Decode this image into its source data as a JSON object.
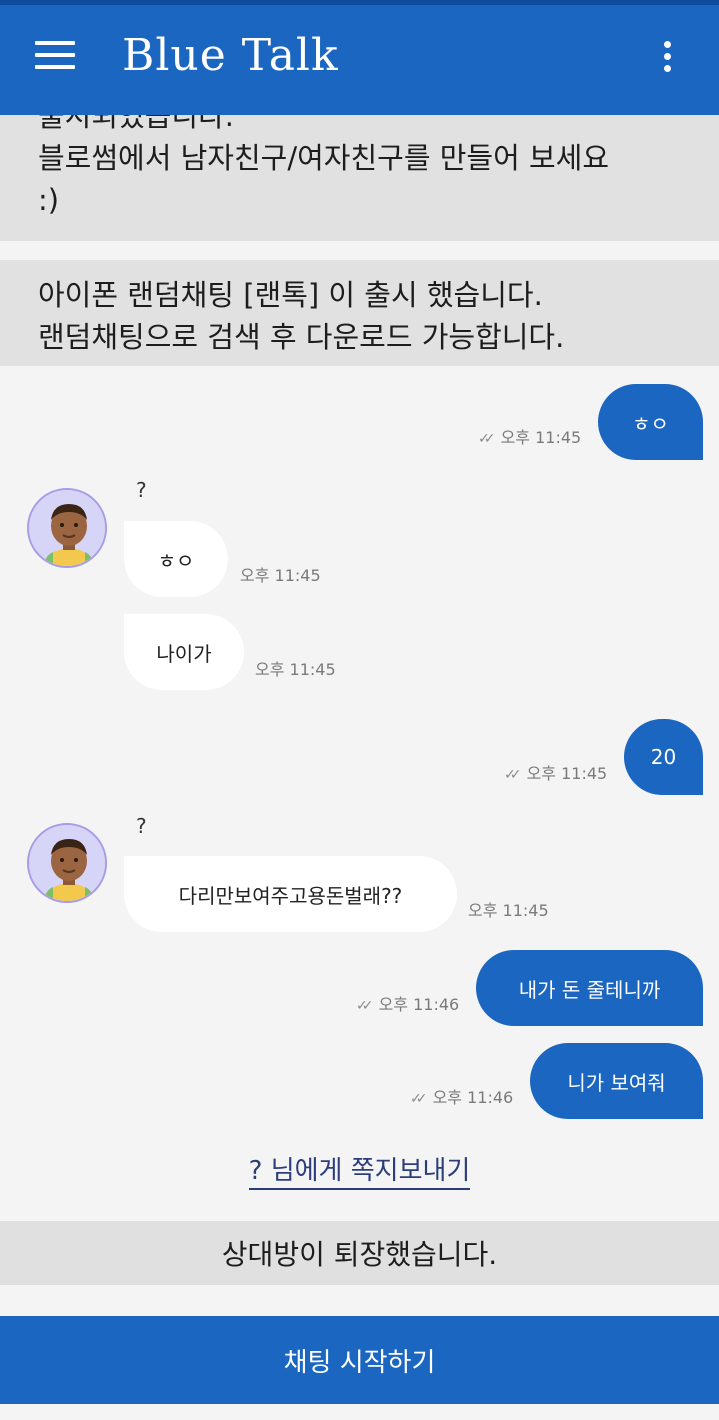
{
  "app": {
    "title": "Blue Talk"
  },
  "notices": [
    {
      "lines": [
        "출시되었습니다.",
        "블로썸에서 남자친구/여자친구를 만들어 보세요",
        ":)"
      ]
    },
    {
      "lines": [
        "아이폰 랜덤채팅 [랜톡] 이 출시 했습니다.",
        "랜덤채팅으로 검색 후 다운로드 가능합니다."
      ]
    }
  ],
  "messages": [
    {
      "dir": "out",
      "text": "ㅎㅇ",
      "time": "오후 11:45"
    },
    {
      "dir": "in",
      "sender": "?",
      "text": "ㅎㅇ",
      "time": "오후 11:45"
    },
    {
      "dir": "in",
      "text": "나이가",
      "time": "오후 11:45"
    },
    {
      "dir": "out",
      "text": "20",
      "time": "오후 11:45"
    },
    {
      "dir": "in",
      "sender": "?",
      "text": "다리만보여주고용돈벌래??",
      "time": "오후 11:45"
    },
    {
      "dir": "out",
      "text": "내가 돈 줄테니까",
      "time": "오후 11:46"
    },
    {
      "dir": "out",
      "text": "니가 보여줘",
      "time": "오후 11:46"
    }
  ],
  "send_note_label": "? 님에게 쪽지보내기",
  "leave_notice": "상대방이 퇴장했습니다.",
  "start_button": "채팅 시작하기",
  "icons": {
    "menu": "hamburger-menu-icon",
    "more": "more-vertical-icon",
    "read": "double-check-icon",
    "avatar": "avatar-icon"
  },
  "colors": {
    "primary": "#1b66c0",
    "background": "#f4f4f5",
    "notice_bg": "#e1e1e1"
  }
}
